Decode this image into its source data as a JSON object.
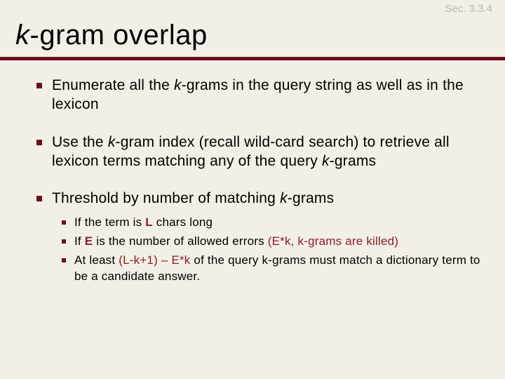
{
  "section": "Sec. 3.3.4",
  "title_prefix": "k",
  "title_rest": "-gram overlap",
  "bullets": {
    "b1_a": "Enumerate all the ",
    "b1_k": "k",
    "b1_b": "-grams in the query string as well as in the lexicon",
    "b2_a": "Use the ",
    "b2_k": "k",
    "b2_b": "-gram index (recall wild-card search) to retrieve all lexicon terms matching any of the query ",
    "b2_k2": "k",
    "b2_c": "-grams",
    "b3_a": "Threshold by number of matching ",
    "b3_k": "k",
    "b3_b": "-grams"
  },
  "sub": {
    "s1_a": "If the term is ",
    "s1_L": "L",
    "s1_b": " chars long",
    "s2_a": "If ",
    "s2_E": "E",
    "s2_b": " is the number of allowed errors  ",
    "s2_c": "(E*k, k-grams are killed)",
    "s3_a": "At least ",
    "s3_b": "(L-k+1) – E*k",
    "s3_c": " of the query k-grams must match a dictionary term to be a candidate answer."
  }
}
